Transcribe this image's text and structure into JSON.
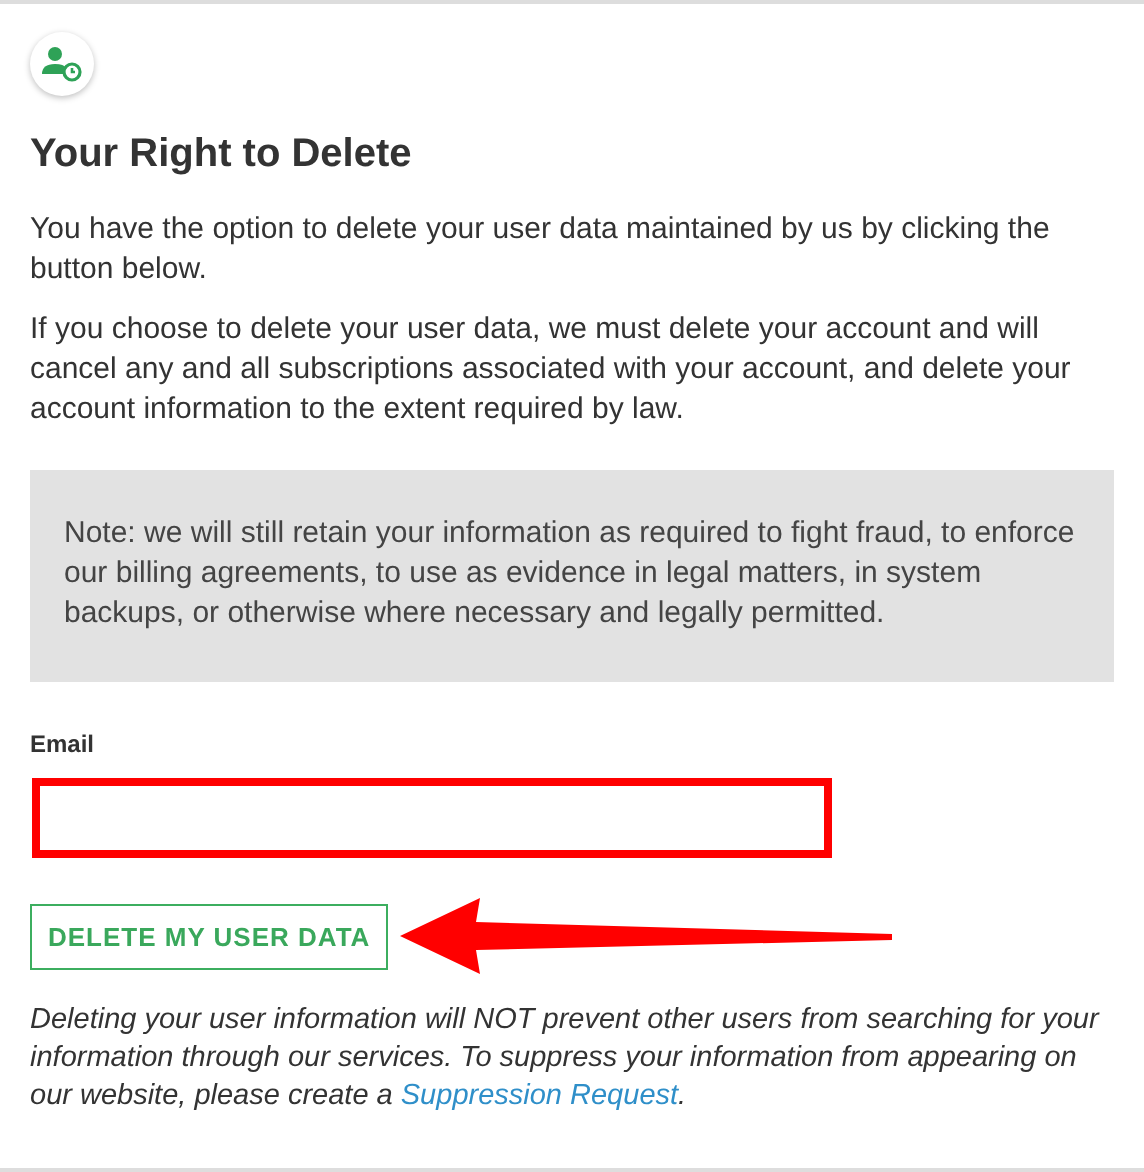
{
  "title": "Your Right to Delete",
  "paragraphs": [
    "You have the option to delete your user data maintained by us by clicking the button below.",
    "If you choose to delete your user data, we must delete your account and will cancel any and all subscriptions associated with your account, and delete your account information to the extent required by law."
  ],
  "note": "Note: we will still retain your information as required to fight fraud, to enforce our billing agreements, to use as evidence in legal matters, in system backups, or otherwise where necessary and legally permitted.",
  "email": {
    "label": "Email",
    "highlighted": true
  },
  "button": {
    "label": "DELETE MY USER DATA",
    "arrow": true
  },
  "disclaimer": {
    "before": "Deleting your user information will NOT prevent other users from searching for your information through our services. To suppress your information from appearing on our website, please create a ",
    "link": "Suppression Request",
    "after": "."
  }
}
